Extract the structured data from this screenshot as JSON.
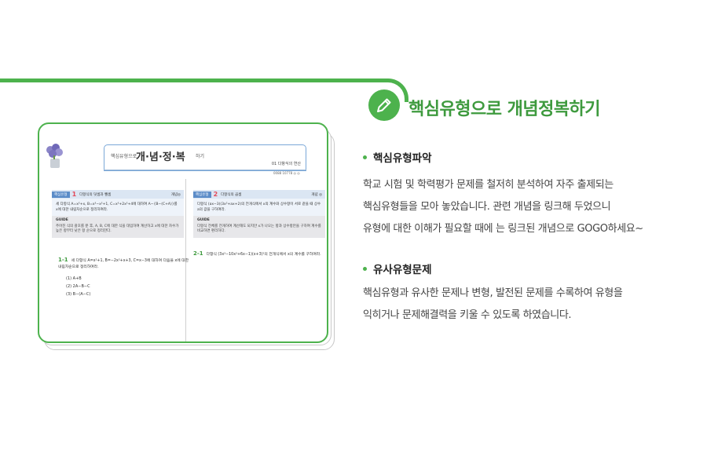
{
  "header": {
    "icon": "pencil-icon",
    "title": "핵심유형으로 개념정복하기",
    "accent_color": "#4db24d"
  },
  "preview": {
    "title_small": "핵심유형으로",
    "title_main": "개·념·정·복",
    "title_sub": "하기",
    "chapter": "01 다항식의 연산",
    "page_code": "0088 10778 ◎ ◎",
    "left_question": {
      "tag": "핵심유형",
      "num": "1",
      "title": "다항식의 덧셈과 뺄셈",
      "level": "개념◎",
      "body": "세 다항식 A=x²+x, B=x³−x²+1, C=x³+2x²+4에 대하여 A−{B−(C+A)}를 x에 대한 내림차순으로 정리하여라.",
      "guide_label": "GUIDE",
      "guide": "주어진 식의 괄호를 푼 후, A, B, C에 대한 식을 대입하여 계산하고 x에 대한 차수가 높은 항부터 낮은 항 순으로 정리한다."
    },
    "left_sub": {
      "num": "1-1",
      "text": "세 다항식 A=x²+1, B=−2x²+x+3, C=x−3에 대하여 다음을 x에 대한 내림차순으로 정리하여라.",
      "options": [
        "(1) A+B",
        "(2) 2A−B−C",
        "(3) B−(A−C)"
      ]
    },
    "right_question": {
      "tag": "핵심유형",
      "num": "2",
      "title": "다항식의 곱셈",
      "level": "개념 ◎",
      "body": "다항식 (ax−3)(3x²+ax+2)의 전개식에서 x의 계수와 상수항이 서로 같을 때 상수 a의 값을 구하여라.",
      "guide_label": "GUIDE",
      "guide": "다항식 전체를 전개하여 계산해도 되지만 x가 나오는 항과 상수항만을 구하여 계수를 비교하면 편리하다."
    },
    "right_sub": {
      "num": "2-1",
      "text": "다항식 (3x³−10x²+6x−1)(x+3)²의 전개식에서 x의 계수를 구하여라."
    }
  },
  "sections": [
    {
      "title": "핵심유형파악",
      "lines": [
        "학교 시험 및 학력평가 문제를 철저히 분석하여 자주 출제되는",
        "핵심유형들을 모아 놓았습니다. 관련 개념을 링크해 두었으니",
        "유형에 대한 이해가 필요할 때에 는 링크된 개념으로 GOGO하세요~"
      ]
    },
    {
      "title": "유사유형문제",
      "lines": [
        "핵심유형과 유사한 문제나 변형, 발전된 문제를 수록하여 유형을",
        "익히거나 문제해결력을 키울 수 있도록 하였습니다."
      ]
    }
  ]
}
